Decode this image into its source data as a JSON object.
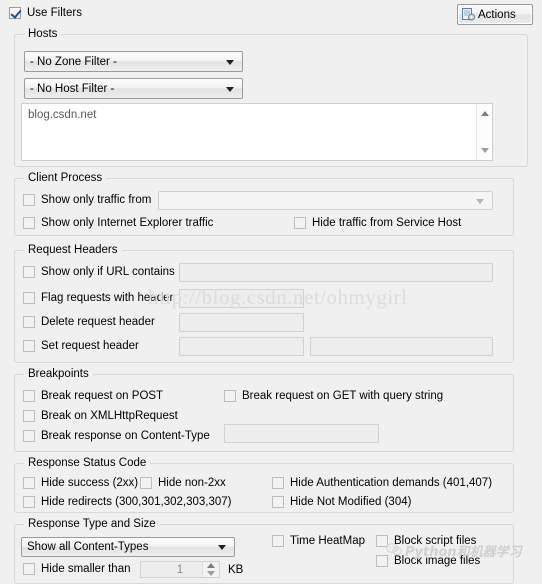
{
  "window": {
    "use_filters_label": "Use Filters",
    "use_filters_checked": true,
    "actions_label": "Actions",
    "actions_icon": "actions-icon"
  },
  "hosts": {
    "title": "Hosts",
    "zone_filter_value": "- No Zone Filter -",
    "host_filter_value": "- No Host Filter -",
    "host_list_value": "blog.csdn.net"
  },
  "client_process": {
    "title": "Client Process",
    "show_only_traffic_from_label": "Show only traffic from",
    "process_combo_value": "",
    "show_only_ie_label": "Show only Internet Explorer traffic",
    "hide_service_host_label": "Hide traffic from Service Host"
  },
  "request_headers": {
    "title": "Request Headers",
    "show_only_if_url_contains_label": "Show only if URL contains",
    "show_only_if_url_contains_value": "",
    "flag_requests_with_header_label": "Flag requests with header",
    "flag_requests_with_header_value": "",
    "delete_request_header_label": "Delete request header",
    "delete_request_header_value": "",
    "set_request_header_label": "Set request header",
    "set_request_header_name_value": "",
    "set_request_header_value_value": ""
  },
  "breakpoints": {
    "title": "Breakpoints",
    "break_request_on_post_label": "Break request on POST",
    "break_request_on_get_label": "Break request on GET with query string",
    "break_on_xhr_label": "Break on XMLHttpRequest",
    "break_response_on_content_type_label": "Break response on Content-Type",
    "break_response_on_content_type_value": ""
  },
  "response_status_code": {
    "title": "Response Status Code",
    "hide_success_label": "Hide success (2xx)",
    "hide_non_2xx_label": "Hide non-2xx",
    "hide_auth_demands_label": "Hide Authentication demands (401,407)",
    "hide_redirects_label": "Hide redirects (300,301,302,303,307)",
    "hide_not_modified_label": "Hide Not Modified (304)"
  },
  "response_type_and_size": {
    "title": "Response Type and Size",
    "content_types_value": "Show all Content-Types",
    "time_heatmap_label": "Time HeatMap",
    "block_script_files_label": "Block script files",
    "block_image_files_label": "Block image files",
    "hide_smaller_than_label": "Hide smaller than",
    "hide_smaller_than_value": "1",
    "kb_label": "KB"
  },
  "watermarks": {
    "url": "http://blog.csdn.net/ohmygirl",
    "wechat_text": "Python和机器学习"
  },
  "colors": {
    "window_bg": "#f0f0f0",
    "group_border": "#d7d7d7",
    "check_accent": "#1c4f91",
    "watermark": "#dcdcdc"
  }
}
